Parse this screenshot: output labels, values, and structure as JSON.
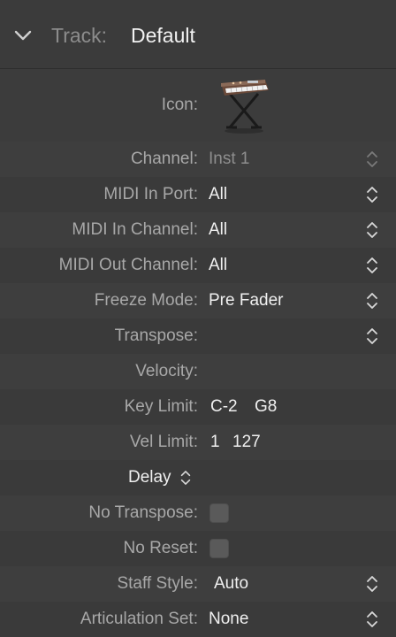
{
  "header": {
    "title_label": "Track:",
    "title_value": "Default"
  },
  "icon_row": {
    "label": "Icon:"
  },
  "rows": [
    {
      "label": "Channel:",
      "value": "Inst 1"
    },
    {
      "label": "MIDI In Port:",
      "value": "All"
    },
    {
      "label": "MIDI In Channel:",
      "value": "All"
    },
    {
      "label": "MIDI Out Channel:",
      "value": "All"
    },
    {
      "label": "Freeze Mode:",
      "value": "Pre Fader"
    },
    {
      "label": "Transpose:",
      "value": ""
    },
    {
      "label": "Velocity:",
      "value": ""
    },
    {
      "label": "Key Limit:",
      "low": "C-2",
      "high": "G8"
    },
    {
      "label": "Vel Limit:",
      "low": "1",
      "high": "127"
    },
    {
      "label": "Delay"
    },
    {
      "label": "No Transpose:",
      "checked": false
    },
    {
      "label": "No Reset:",
      "checked": false
    },
    {
      "label": "Staff Style:",
      "value": "Auto"
    },
    {
      "label": "Articulation Set:",
      "value": "None"
    }
  ],
  "icons": {
    "disclosure": "chevron-down-icon",
    "track_icon": "keyboard-stand-icon",
    "stepper": "up-down-stepper-icon"
  }
}
